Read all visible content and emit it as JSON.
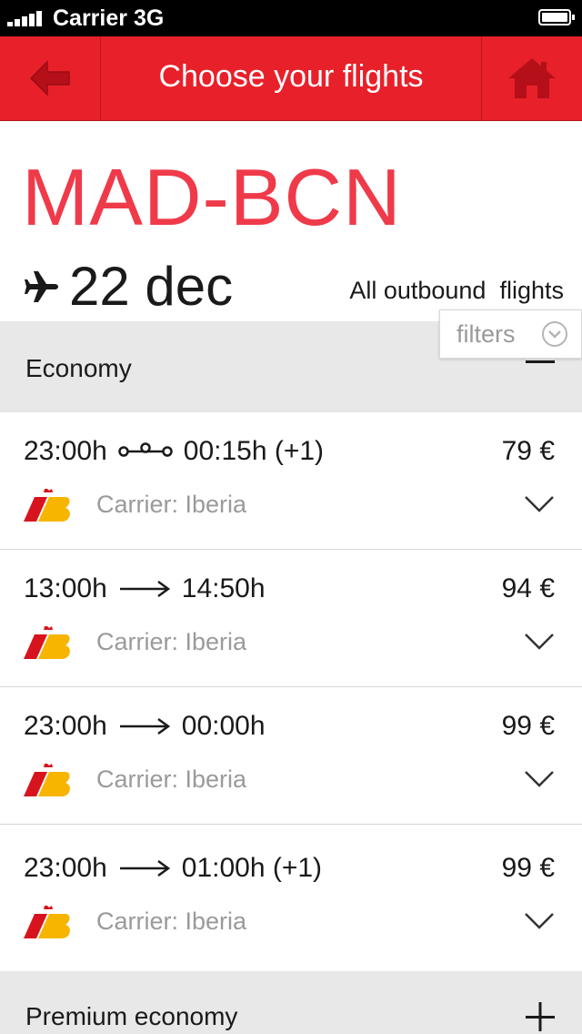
{
  "status_bar": {
    "carrier": "Carrier",
    "network": "3G"
  },
  "navbar": {
    "title": "Choose your flights",
    "back_icon": "arrow-left-icon",
    "home_icon": "home-icon"
  },
  "route": {
    "code": "MAD-BCN",
    "date": "22 dec",
    "outbound_label": "All outbound  flights"
  },
  "filters": {
    "label": "filters"
  },
  "sections": {
    "economy": {
      "title": "Economy",
      "toggle": "minus"
    },
    "premium": {
      "title": "Premium economy",
      "toggle": "plus"
    }
  },
  "flights": [
    {
      "depart": "23:00h",
      "arrive": "00:15h (+1)",
      "connector": "stops",
      "price": "79 €",
      "carrier": "Carrier: Iberia"
    },
    {
      "depart": "13:00h",
      "arrive": "14:50h",
      "connector": "direct",
      "price": "94 €",
      "carrier": "Carrier: Iberia"
    },
    {
      "depart": "23:00h",
      "arrive": "00:00h",
      "connector": "direct",
      "price": "99 €",
      "carrier": "Carrier: Iberia"
    },
    {
      "depart": "23:00h",
      "arrive": "01:00h (+1)",
      "connector": "direct",
      "price": "99 €",
      "carrier": "Carrier: Iberia"
    }
  ],
  "colors": {
    "brand_red": "#e8202a",
    "route_red": "#ef3a4a",
    "section_bg": "#e8e8e8",
    "muted_text": "#9a9a9a",
    "iberia_red": "#d7141e",
    "iberia_yellow": "#f7b500"
  }
}
